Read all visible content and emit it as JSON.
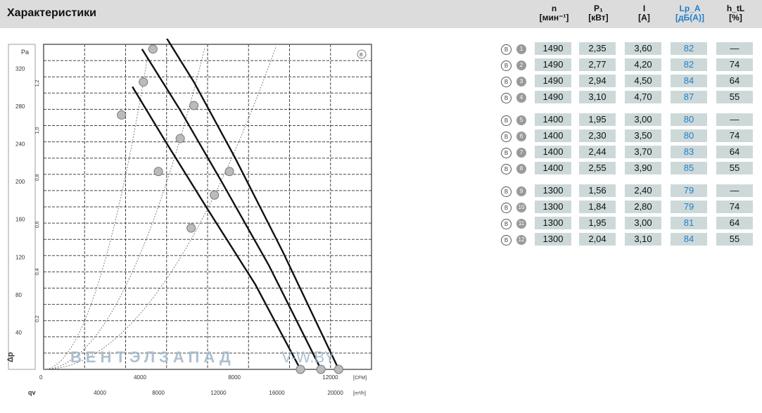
{
  "header": {
    "title": "Характеристики"
  },
  "columns": [
    {
      "top": "n",
      "unit": "[мин⁻¹]",
      "blue": false
    },
    {
      "top": "P₁",
      "unit": "[кВт]",
      "blue": false
    },
    {
      "top": "I",
      "unit": "[A]",
      "blue": false
    },
    {
      "top": "Lp_A",
      "unit": "[дБ(А)]",
      "blue": true
    },
    {
      "top": "h_tL",
      "unit": "[%]",
      "blue": false
    }
  ],
  "rows": [
    {
      "badge": "B",
      "num": "1",
      "n": "1490",
      "p": "2,35",
      "i": "3,60",
      "lp": "82",
      "h": "—"
    },
    {
      "badge": "B",
      "num": "2",
      "n": "1490",
      "p": "2,77",
      "i": "4,20",
      "lp": "82",
      "h": "74"
    },
    {
      "badge": "B",
      "num": "3",
      "n": "1490",
      "p": "2,94",
      "i": "4,50",
      "lp": "84",
      "h": "64"
    },
    {
      "badge": "B",
      "num": "4",
      "n": "1490",
      "p": "3,10",
      "i": "4,70",
      "lp": "87",
      "h": "55"
    },
    {
      "badge": "B",
      "num": "5",
      "n": "1400",
      "p": "1,95",
      "i": "3,00",
      "lp": "80",
      "h": "—"
    },
    {
      "badge": "B",
      "num": "6",
      "n": "1400",
      "p": "2,30",
      "i": "3,50",
      "lp": "80",
      "h": "74"
    },
    {
      "badge": "B",
      "num": "7",
      "n": "1400",
      "p": "2,44",
      "i": "3,70",
      "lp": "83",
      "h": "64"
    },
    {
      "badge": "B",
      "num": "8",
      "n": "1400",
      "p": "2,55",
      "i": "3,90",
      "lp": "85",
      "h": "55"
    },
    {
      "badge": "B",
      "num": "9",
      "n": "1300",
      "p": "1,56",
      "i": "2,40",
      "lp": "79",
      "h": "—"
    },
    {
      "badge": "B",
      "num": "10",
      "n": "1300",
      "p": "1,84",
      "i": "2,80",
      "lp": "79",
      "h": "74"
    },
    {
      "badge": "B",
      "num": "11",
      "n": "1300",
      "p": "1,95",
      "i": "3,00",
      "lp": "81",
      "h": "64"
    },
    {
      "badge": "B",
      "num": "12",
      "n": "1300",
      "p": "2,04",
      "i": "3,10",
      "lp": "84",
      "h": "55"
    }
  ],
  "chart_data": {
    "type": "line",
    "badge": "B",
    "xlim": [
      0,
      24000
    ],
    "ylim": [
      0,
      320
    ],
    "x_ticks_m3h": [
      "4000",
      "8000",
      "12000",
      "16000",
      "20000"
    ],
    "x_unit_m3h": "[m³/h]",
    "x_ticks_cfm": [
      "0",
      "4000",
      "8000",
      "12000"
    ],
    "x_unit_cfm": "[CFM]",
    "y_ticks_pa": [
      "40",
      "80",
      "120",
      "160",
      "200",
      "240",
      "280",
      "320"
    ],
    "y_unit_pa": "Pa",
    "y_ticks_inwg": [
      "0,2",
      "0,4",
      "0,6",
      "0,8",
      "1,0",
      "1,2"
    ],
    "y_axis_symbol": "Δp",
    "x_axis_symbol": "qv",
    "series": [
      {
        "values": [
          [
            6500,
            300
          ],
          [
            9000,
            240
          ],
          [
            12000,
            170
          ],
          [
            15500,
            90
          ],
          [
            18800,
            0
          ]
        ]
      },
      {
        "values": [
          [
            7200,
            340
          ],
          [
            10000,
            275
          ],
          [
            13000,
            200
          ],
          [
            16500,
            110
          ],
          [
            20300,
            0
          ]
        ]
      },
      {
        "values": [
          [
            8000,
            375
          ],
          [
            11000,
            305
          ],
          [
            14000,
            225
          ],
          [
            17500,
            125
          ],
          [
            21600,
            0
          ]
        ]
      }
    ],
    "points": [
      {
        "num": "1",
        "x": 20300,
        "y": 0
      },
      {
        "num": "2",
        "x": 8000,
        "y": 340
      },
      {
        "num": "3",
        "x": 11000,
        "y": 280
      },
      {
        "num": "4",
        "x": 13600,
        "y": 210
      },
      {
        "num": "5",
        "x": 21600,
        "y": 0
      },
      {
        "num": "6",
        "x": 7300,
        "y": 305
      },
      {
        "num": "7",
        "x": 10000,
        "y": 245
      },
      {
        "num": "8",
        "x": 12500,
        "y": 185
      },
      {
        "num": "9",
        "x": 18800,
        "y": 0
      },
      {
        "num": "10",
        "x": 5700,
        "y": 270
      },
      {
        "num": "11",
        "x": 8400,
        "y": 210
      },
      {
        "num": "12",
        "x": 10800,
        "y": 150
      }
    ],
    "watermark": "ВЕНТЭЛЗАПАД",
    "watermark2": "V-W.BY"
  }
}
